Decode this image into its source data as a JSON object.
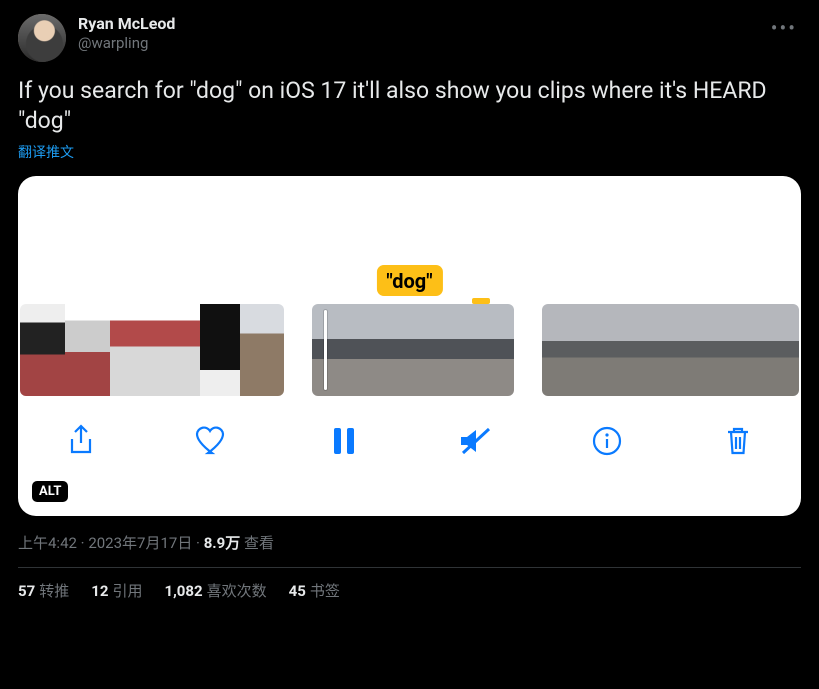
{
  "author": {
    "display_name": "Ryan McLeod",
    "handle": "@warpling"
  },
  "tweet_text": "If you search for \"dog\" on iOS 17 it'll also show you clips where it's HEARD \"dog\"",
  "translate_label": "翻译推文",
  "media": {
    "caption_tag": "\"dog\"",
    "alt_badge": "ALT",
    "toolbar_icons": [
      "share",
      "heart",
      "pause",
      "mute",
      "info",
      "trash"
    ]
  },
  "meta": {
    "time": "上午4:42",
    "date": "2023年7月17日",
    "views_number": "8.9万",
    "views_label": "查看",
    "separator": " · "
  },
  "stats": {
    "retweets": {
      "count": "57",
      "label": "转推"
    },
    "quotes": {
      "count": "12",
      "label": "引用"
    },
    "likes": {
      "count": "1,082",
      "label": "喜欢次数"
    },
    "bookmarks": {
      "count": "45",
      "label": "书签"
    }
  }
}
